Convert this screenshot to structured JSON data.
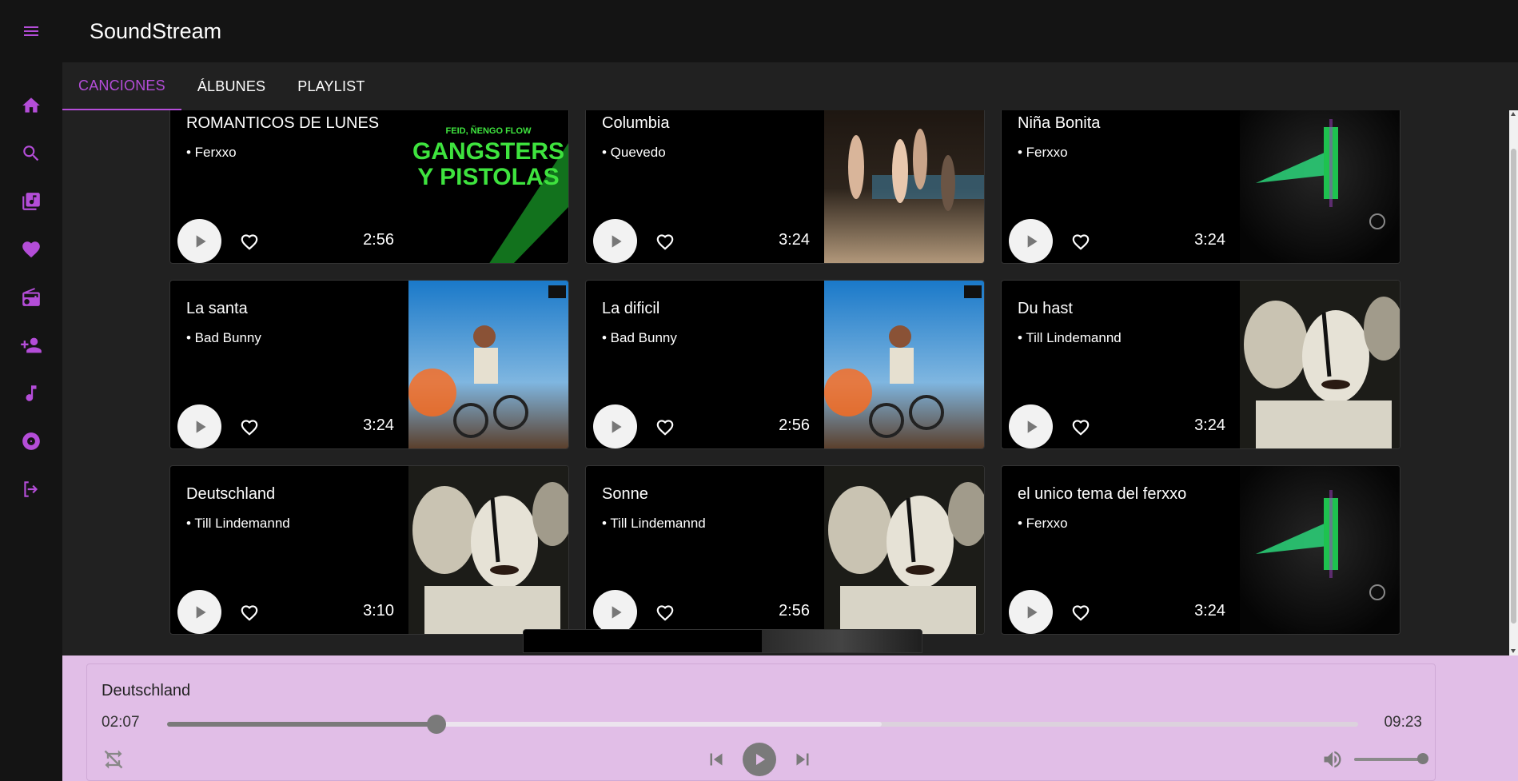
{
  "app": {
    "title": "SoundStream"
  },
  "colors": {
    "accent": "#b44dd8",
    "player_bg": "#e1bee7"
  },
  "sidebar": {
    "items": [
      {
        "name": "home",
        "icon": "home-icon"
      },
      {
        "name": "search",
        "icon": "search-icon"
      },
      {
        "name": "library",
        "icon": "library-music-icon"
      },
      {
        "name": "favorites",
        "icon": "heart-icon"
      },
      {
        "name": "radio",
        "icon": "radio-icon"
      },
      {
        "name": "add-artist",
        "icon": "person-add-icon"
      },
      {
        "name": "songs",
        "icon": "music-note-icon"
      },
      {
        "name": "albums",
        "icon": "album-icon"
      },
      {
        "name": "logout",
        "icon": "logout-icon"
      }
    ]
  },
  "tabs": [
    {
      "label": "CANCIONES",
      "active": true
    },
    {
      "label": "ÁLBUNES",
      "active": false
    },
    {
      "label": "PLAYLIST",
      "active": false
    }
  ],
  "songs": [
    {
      "title": "ROMANTICOS DE LUNES",
      "artist": "• Ferxxo",
      "duration": "2:56",
      "cover": "gangsters-y-pistolas",
      "cover_text": [
        "FEID, ÑENGO FLOW",
        "GANGSTERS",
        "Y PISTOLAS"
      ]
    },
    {
      "title": "Columbia",
      "artist": "• Quevedo",
      "duration": "3:24",
      "cover": "pool-party"
    },
    {
      "title": "Niña Bonita",
      "artist": "• Ferxxo",
      "duration": "3:24",
      "cover": "ferxxo-green"
    },
    {
      "title": "La santa",
      "artist": "• Bad Bunny",
      "duration": "3:24",
      "cover": "bicycle-explosion"
    },
    {
      "title": "La dificil",
      "artist": "• Bad Bunny",
      "duration": "2:56",
      "cover": "bicycle-explosion"
    },
    {
      "title": "Du hast",
      "artist": "• Till Lindemannd",
      "duration": "3:24",
      "cover": "faces"
    },
    {
      "title": "Deutschland",
      "artist": "• Till Lindemannd",
      "duration": "3:10",
      "cover": "faces"
    },
    {
      "title": "Sonne",
      "artist": "• Till Lindemannd",
      "duration": "2:56",
      "cover": "faces"
    },
    {
      "title": "el unico tema del ferxxo",
      "artist": "• Ferxxo",
      "duration": "3:24",
      "cover": "ferxxo-green"
    }
  ],
  "player": {
    "title": "Deutschland",
    "current_time": "02:07",
    "total_time": "09:23",
    "progress": 0.226,
    "buffered": 0.6,
    "volume": 1.0
  }
}
